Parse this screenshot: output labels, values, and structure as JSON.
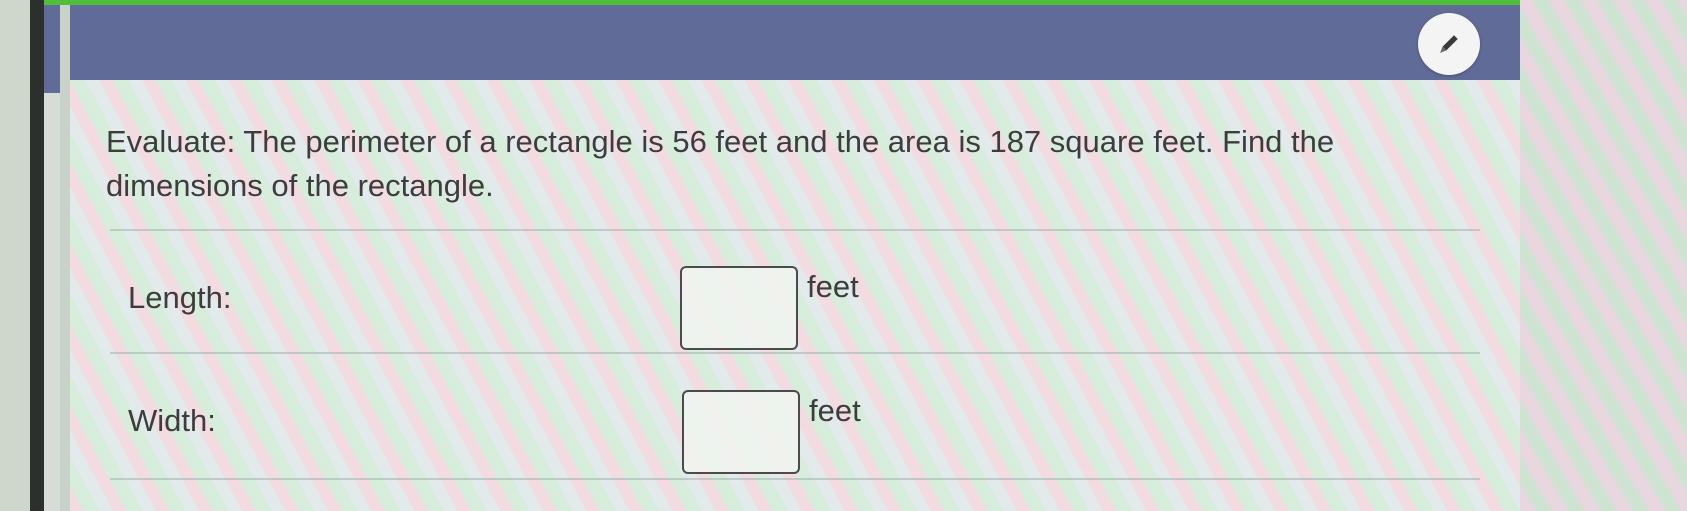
{
  "question": {
    "text": "Evaluate: The perimeter of a rectangle is 56 feet and the area is 187 square feet. Find the dimensions of the rectangle."
  },
  "fields": [
    {
      "label": "Length:",
      "value": "",
      "unit": "feet"
    },
    {
      "label": "Width:",
      "value": "",
      "unit": "feet"
    }
  ],
  "toolbar": {
    "edit_icon": "pencil-icon"
  },
  "colors": {
    "header": "#616b97",
    "accent_strip": "#4fbf3a",
    "text": "#3d3d3d"
  }
}
